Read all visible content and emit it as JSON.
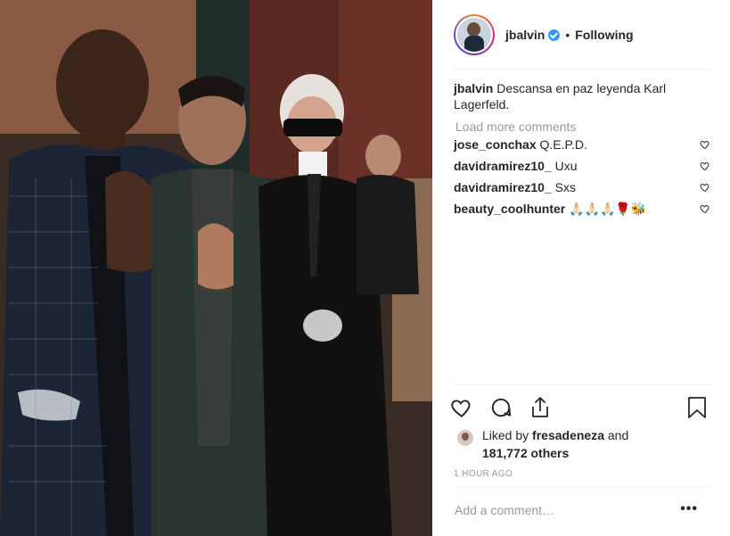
{
  "post": {
    "author": "jbalvin",
    "following_label": "Following",
    "separator": "•",
    "caption": "Descansa en paz leyenda Karl Lagerfeld.",
    "load_more": "Load more comments",
    "comments": [
      {
        "user": "jose_conchax",
        "text": "Q.E.P.D."
      },
      {
        "user": "davidramirez10_",
        "text": "Uxu"
      },
      {
        "user": "davidramirez10_",
        "text": "Sxs"
      },
      {
        "user": "beauty_coolhunter",
        "text": "🙏🏻🙏🏻🙏🏻🌹🐝"
      }
    ],
    "likes": {
      "prefix": "Liked by",
      "user": "fresadeneza",
      "conj": "and",
      "count": "181,772 others"
    },
    "time": "1 HOUR AGO",
    "add_comment_placeholder": "Add a comment…",
    "more_label": "•••"
  },
  "icons": {
    "verified": "verified-badge-icon",
    "like": "heart-icon",
    "comment": "comment-icon",
    "share": "share-icon",
    "save": "bookmark-icon"
  },
  "colors": {
    "verified": "#3897f0",
    "muted": "#999999",
    "text": "#262626"
  }
}
